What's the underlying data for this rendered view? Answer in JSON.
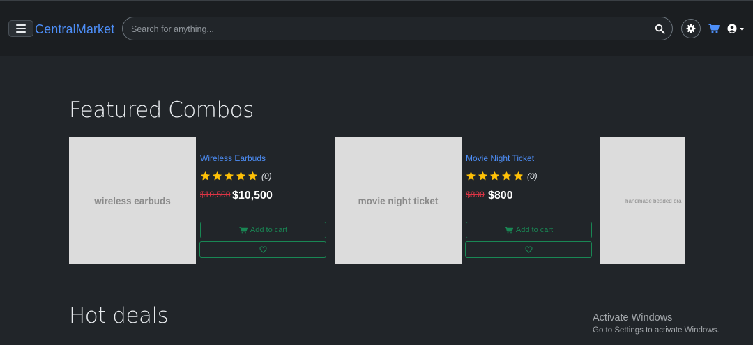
{
  "header": {
    "brand": "CentralMarket",
    "search_placeholder": "Search for anything..."
  },
  "sections": {
    "featured_title": "Featured Combos",
    "hot_deals_title": "Hot deals"
  },
  "products": [
    {
      "image_alt": "wireless earbuds",
      "name": "Wireless Earbuds",
      "rating": 5,
      "rating_count": "(0)",
      "old_price": "$10,500",
      "price": "$10,500",
      "add_to_cart": "Add to cart"
    },
    {
      "image_alt": "movie night ticket",
      "name": "Movie Night Ticket",
      "rating": 5,
      "rating_count": "(0)",
      "old_price": "$800",
      "price": "$800",
      "add_to_cart": "Add to cart"
    },
    {
      "image_alt": "handmade beaded bra"
    }
  ],
  "watermark": {
    "title": "Activate Windows",
    "subtitle": "Go to Settings to activate Windows."
  },
  "colors": {
    "background": "#212529",
    "navbar": "#1b1e21",
    "brand": "#4d8ef7",
    "star": "#ffc107",
    "outline_button": "#198754",
    "old_price": "#dc3545"
  }
}
